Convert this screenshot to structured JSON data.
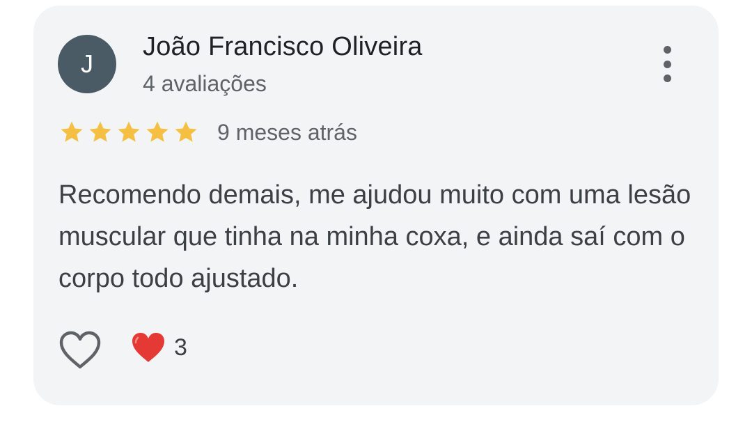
{
  "review": {
    "avatar_initial": "J",
    "avatar_color": "#4a5b66",
    "reviewer_name": "João Francisco Oliveira",
    "review_count": "4 avaliações",
    "rating": 5,
    "rating_max": 5,
    "star_color": "#f4bf42",
    "time_ago": "9 meses atrás",
    "text": "Recomendo demais, me ajudou muito com uma lesão muscular que tinha na minha coxa, e ainda saí com o corpo todo ajustado.",
    "more_icon": "more-vertical-icon",
    "like_icon": "heart-outline-icon",
    "reaction_icon": "red-heart-emoji",
    "reaction_color": "#e53935",
    "reaction_count": "3"
  }
}
